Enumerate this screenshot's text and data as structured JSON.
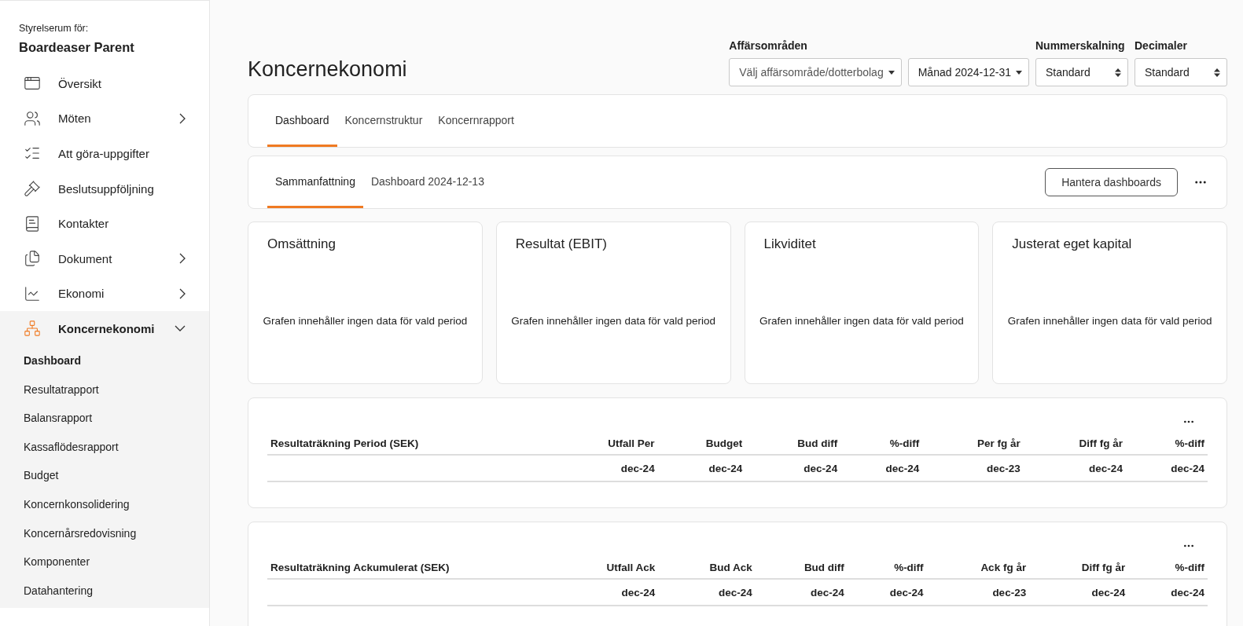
{
  "sidebar": {
    "caption": "Styrelserum för:",
    "org": "Boardeaser Parent",
    "items": [
      {
        "kind": "link",
        "label": "Översikt"
      },
      {
        "kind": "group",
        "label": "Möten",
        "expanded": false
      },
      {
        "kind": "link",
        "label": "Att göra-uppgifter"
      },
      {
        "kind": "link",
        "label": "Beslutsuppföljning"
      },
      {
        "kind": "link",
        "label": "Kontakter"
      },
      {
        "kind": "group",
        "label": "Dokument",
        "expanded": false
      },
      {
        "kind": "group",
        "label": "Ekonomi",
        "expanded": false
      },
      {
        "kind": "group",
        "label": "Koncernekonomi",
        "expanded": true,
        "children": [
          {
            "label": "Dashboard",
            "selected": true
          },
          {
            "label": "Resultatrapport",
            "selected": false
          },
          {
            "label": "Balansrapport",
            "selected": false
          },
          {
            "label": "Kassaflödesrapport",
            "selected": false
          },
          {
            "label": "Budget",
            "selected": false
          },
          {
            "label": "Koncernkonsolidering",
            "selected": false
          },
          {
            "label": "Koncernårsredovisning",
            "selected": false
          },
          {
            "label": "Komponenter",
            "selected": false
          },
          {
            "label": "Datahantering",
            "selected": false
          }
        ]
      }
    ]
  },
  "page_title": "Koncernekonomi",
  "filter_groups": [
    {
      "label": "Affärsområden",
      "controls": [
        {
          "kind": "dropdown",
          "placeholder": "Välj affärsområde/dotterbolag"
        },
        {
          "kind": "dropdown",
          "value": "Månad 2024-12-31"
        }
      ]
    },
    {
      "label": "Nummerskalning",
      "controls": [
        {
          "kind": "stepper",
          "value": "Standard"
        }
      ]
    },
    {
      "label": "Decimaler",
      "controls": [
        {
          "kind": "stepper",
          "value": "Standard"
        }
      ]
    }
  ],
  "tabs": [
    {
      "label": "Dashboard",
      "selected": true
    },
    {
      "label": "Koncernstruktur",
      "selected": false
    },
    {
      "label": "Koncernrapport",
      "selected": false
    }
  ],
  "subtabs": [
    {
      "label": "Sammanfattning",
      "selected": true
    },
    {
      "label": "Dashboard 2024-12-13",
      "selected": false
    }
  ],
  "manage_button": "Hantera dashboards",
  "cards": [
    {
      "title": "Omsättning",
      "message": "Grafen innehåller ingen data för vald period"
    },
    {
      "title": "Resultat (EBIT)",
      "message": "Grafen innehåller ingen data för vald period"
    },
    {
      "title": "Likviditet",
      "message": "Grafen innehåller ingen data för vald period"
    },
    {
      "title": "Justerat eget kapital",
      "message": "Grafen innehåller ingen data för vald period"
    }
  ],
  "tables": [
    {
      "columns": [
        "Resultaträkning Period (SEK)",
        "Utfall Per",
        "Budget",
        "Bud diff",
        "%-diff",
        "Per fg år",
        "Diff fg år",
        "%-diff"
      ],
      "rows": [
        [
          "",
          "dec-24",
          "dec-24",
          "dec-24",
          "dec-24",
          "dec-23",
          "dec-24",
          "dec-24"
        ]
      ]
    },
    {
      "columns": [
        "Resultaträkning Ackumulerat (SEK)",
        "Utfall Ack",
        "Bud Ack",
        "Bud diff",
        "%-diff",
        "Ack fg år",
        "Diff fg år",
        "%-diff"
      ],
      "rows": [
        [
          "",
          "dec-24",
          "dec-24",
          "dec-24",
          "dec-24",
          "dec-23",
          "dec-24",
          "dec-24"
        ]
      ]
    }
  ]
}
